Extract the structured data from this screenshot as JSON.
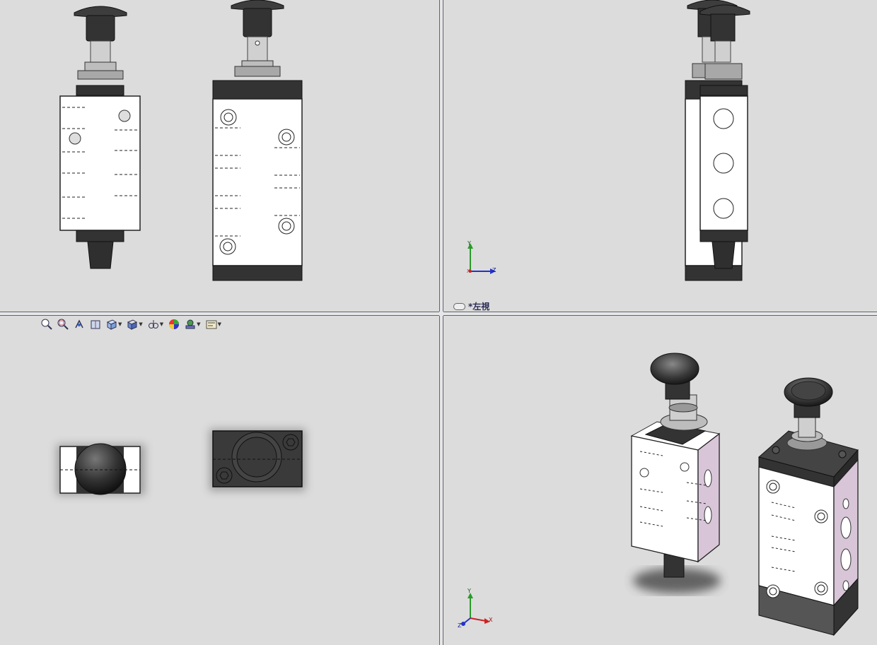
{
  "viewports": {
    "top_left": {
      "name": "front-view"
    },
    "top_right": {
      "name": "left-view",
      "label": "*左視"
    },
    "bottom_left": {
      "name": "top-view"
    },
    "bottom_right": {
      "name": "isometric-view"
    }
  },
  "triad_top_right": {
    "axis_up": "Y",
    "axis_right": "Z",
    "axis_origin": "X"
  },
  "triad_bottom_right": {
    "axis_up": "Y",
    "axis_right": "X",
    "axis_left": "Z"
  },
  "toolbar": {
    "items": [
      {
        "icon": "zoom-to-fit-icon",
        "dropdown": false
      },
      {
        "icon": "zoom-to-area-icon",
        "dropdown": false
      },
      {
        "icon": "previous-view-icon",
        "dropdown": false
      },
      {
        "icon": "section-view-icon",
        "dropdown": false
      },
      {
        "icon": "view-orientation-icon",
        "dropdown": true
      },
      {
        "icon": "display-style-icon",
        "dropdown": true
      },
      {
        "icon": "hide-show-items-icon",
        "dropdown": true
      },
      {
        "icon": "edit-appearance-icon",
        "dropdown": false
      },
      {
        "icon": "apply-scene-icon",
        "dropdown": true
      },
      {
        "icon": "view-settings-icon",
        "dropdown": true
      }
    ]
  },
  "colors": {
    "background": "#dcdcdc",
    "body_white": "#ffffff",
    "dark_parts": "#3a3a3a",
    "side_pink": "#d8c6d8",
    "axis_y": "#2a9a2a",
    "axis_x": "#cc2222",
    "axis_z": "#2233cc"
  }
}
